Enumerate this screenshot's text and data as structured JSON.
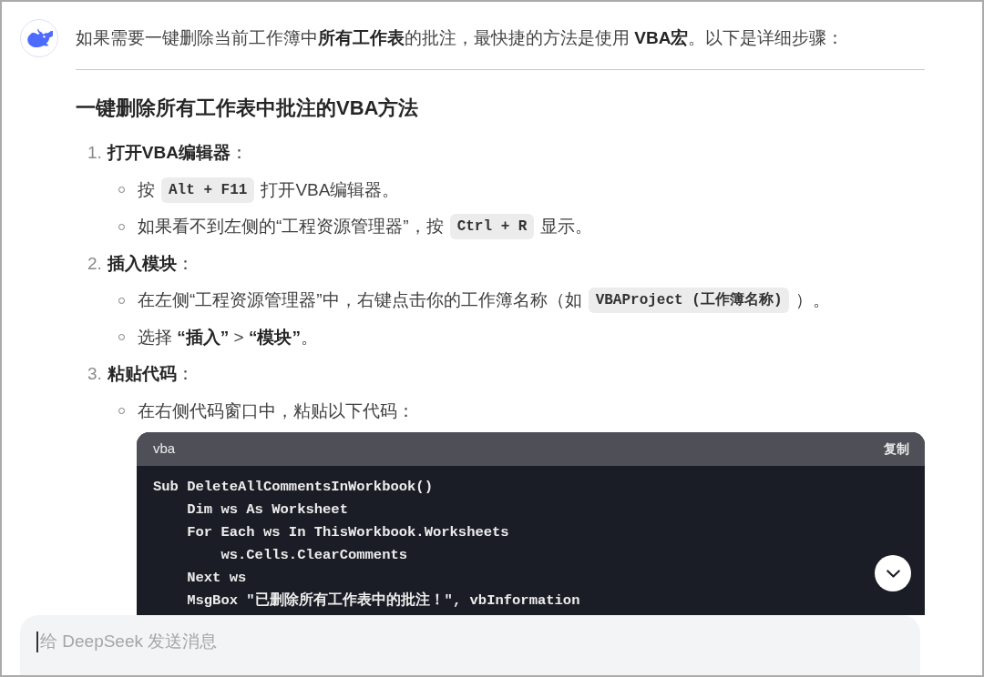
{
  "message": {
    "intro": "如果需要一键删除当前工作簿中**所有工作表**的批注，最快捷的方法是使用 **VBA宏**。以下是详细步骤：",
    "heading": "一键删除所有工作表中批注的VBA方法",
    "steps": [
      {
        "number": "1.",
        "title": "**打开VBA编辑器**：",
        "bullets": [
          {
            "segments": [
              {
                "kind": "text",
                "text": "按"
              },
              {
                "kind": "code",
                "text": "Alt + F11"
              },
              {
                "kind": "text",
                "text": "打开VBA编辑器。"
              }
            ]
          },
          {
            "segments": [
              {
                "kind": "text",
                "text": "如果看不到左侧的“工程资源管理器”，按"
              },
              {
                "kind": "code",
                "text": "Ctrl + R"
              },
              {
                "kind": "text",
                "text": "显示。"
              }
            ]
          }
        ]
      },
      {
        "number": "2.",
        "title": "**插入模块**：",
        "bullets": [
          {
            "segments": [
              {
                "kind": "text",
                "text": "在左侧“工程资源管理器”中，右键点击你的工作簿名称（如"
              },
              {
                "kind": "code",
                "text": "VBAProject (工作簿名称)"
              },
              {
                "kind": "text",
                "text": "）。"
              }
            ]
          },
          {
            "segments": [
              {
                "kind": "text",
                "text": "选择 **“插入”** > **“模块”**。"
              }
            ]
          }
        ]
      },
      {
        "number": "3.",
        "title": "**粘贴代码**：",
        "bullets": [
          {
            "segments": [
              {
                "kind": "text",
                "text": "在右侧代码窗口中，粘贴以下代码："
              }
            ]
          }
        ]
      }
    ],
    "code_block": {
      "language": "vba",
      "copy_label": "复制",
      "lines": [
        "Sub DeleteAllCommentsInWorkbook()",
        "    Dim ws As Worksheet",
        "    For Each ws In ThisWorkbook.Worksheets",
        "        ws.Cells.ClearComments",
        "    Next ws",
        "    MsgBox \"已删除所有工作表中的批注！\", vbInformation"
      ]
    }
  },
  "composer": {
    "placeholder": "给 DeepSeek 发送消息"
  }
}
